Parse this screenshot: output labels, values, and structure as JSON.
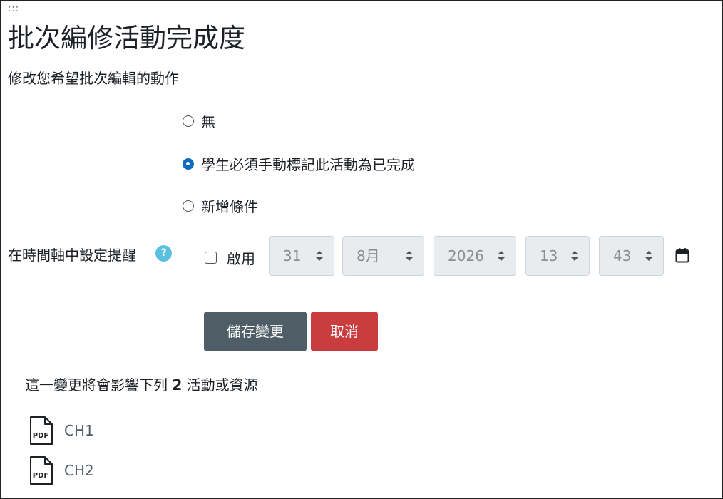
{
  "drag_handle": ":::",
  "page_title": "批次編修活動完成度",
  "subtitle": "修改您希望批次編輯的動作",
  "completion_options": [
    {
      "label": "無",
      "checked": false
    },
    {
      "label": "學生必須手動標記此活動為已完成",
      "checked": true
    },
    {
      "label": "新增條件",
      "checked": false
    }
  ],
  "reminder": {
    "label": "在時間軸中設定提醒",
    "help_icon": "?",
    "enable_label": "啟用",
    "enabled": false,
    "day": "31",
    "month": "8月",
    "year": "2026",
    "hour": "13",
    "minute": "43",
    "calendar_icon": "calendar-icon"
  },
  "buttons": {
    "save": "儲存變更",
    "cancel": "取消"
  },
  "affect": {
    "prefix": "這一變更將會影響下列 ",
    "count": "2",
    "suffix": " 活動或資源"
  },
  "resources": [
    {
      "name": "CH1",
      "icon": "pdf-icon"
    },
    {
      "name": "CH2",
      "icon": "pdf-icon"
    }
  ],
  "colors": {
    "save_button": "#4f5d66",
    "cancel_button": "#ca3d3e",
    "radio_checked": "#0f6cbf",
    "help_icon": "#5bc0de"
  }
}
